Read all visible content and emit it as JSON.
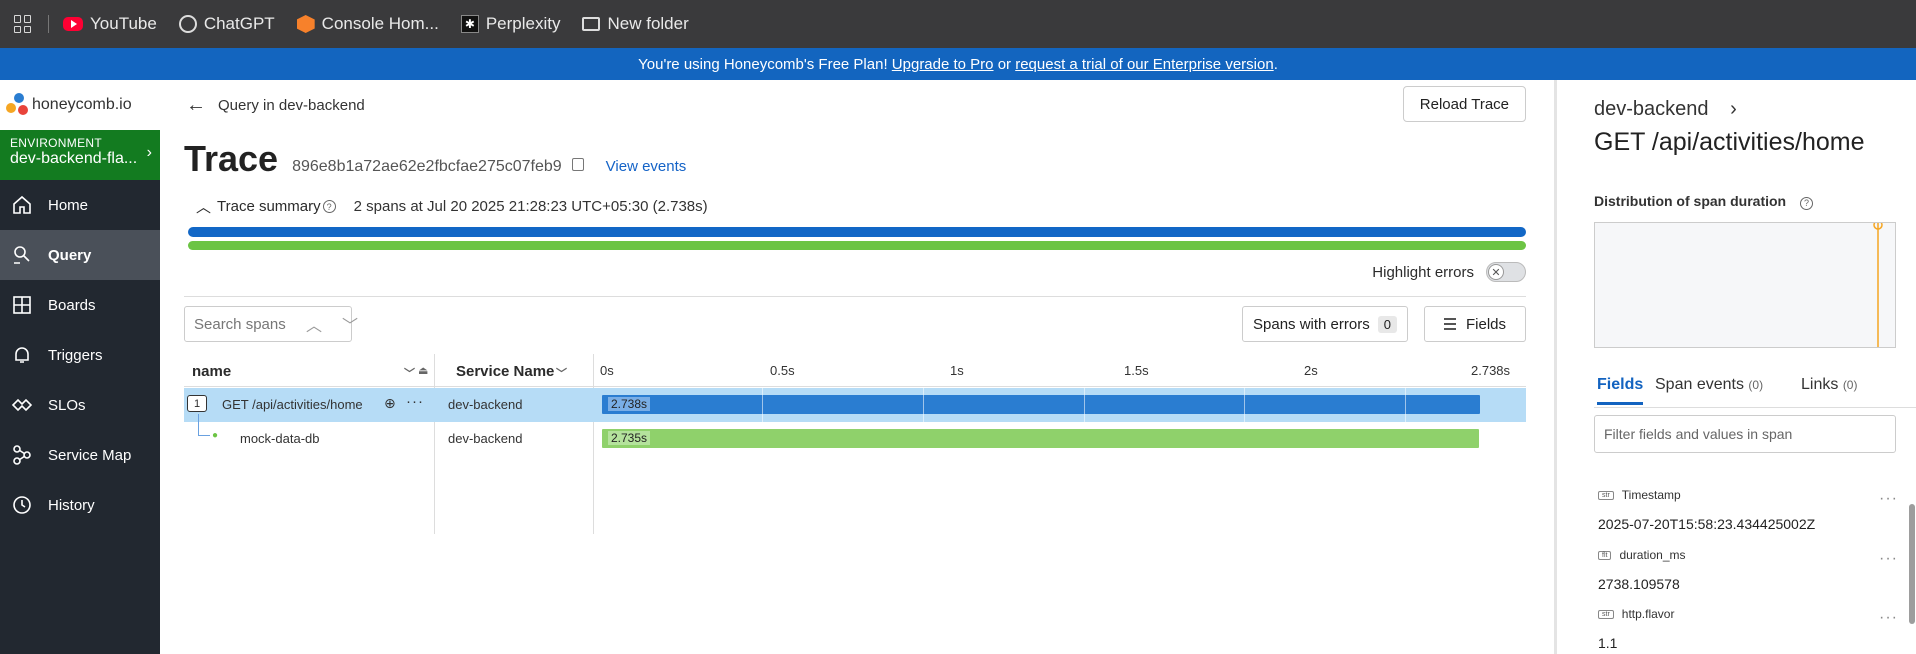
{
  "bookmarks": [
    {
      "label": "YouTube",
      "icon": "youtube-icon"
    },
    {
      "label": "ChatGPT",
      "icon": "chatgpt-icon"
    },
    {
      "label": "Console Hom...",
      "icon": "aws-icon"
    },
    {
      "label": "Perplexity",
      "icon": "perplexity-icon"
    },
    {
      "label": "New folder",
      "icon": "folder-icon"
    }
  ],
  "banner": {
    "prefix": "You're using Honeycomb's Free Plan! ",
    "upgrade": "Upgrade to Pro",
    "middle": " or ",
    "trial": "request a trial of our Enterprise version",
    "suffix": "."
  },
  "nav": {
    "logo": "honeycomb.io",
    "env_label": "ENVIRONMENT",
    "env_value": "dev-backend-fla...",
    "items": [
      {
        "label": "Home",
        "icon": "home-icon"
      },
      {
        "label": "Query",
        "icon": "query-icon",
        "active": true
      },
      {
        "label": "Boards",
        "icon": "boards-icon"
      },
      {
        "label": "Triggers",
        "icon": "bell-icon"
      },
      {
        "label": "SLOs",
        "icon": "slo-icon"
      },
      {
        "label": "Service Map",
        "icon": "service-map-icon"
      },
      {
        "label": "History",
        "icon": "history-icon"
      }
    ]
  },
  "main": {
    "back_label": "Query in dev-backend",
    "reload": "Reload Trace",
    "title": "Trace",
    "trace_id": "896e8b1a72ae62e2fbcfae275c07feb9",
    "view_events": "View events",
    "summary_label": "Trace summary",
    "summary_meta": "2 spans at Jul 20 2025 21:28:23 UTC+05:30 (2.738s)",
    "highlight_errors": "Highlight errors",
    "search_placeholder": "Search spans",
    "spans_with_errors": "Spans with errors",
    "spans_with_errors_count": "0",
    "fields": "Fields",
    "columns": {
      "name": "name",
      "service": "Service Name"
    },
    "ticks": [
      "0s",
      "0.5s",
      "1s",
      "1.5s",
      "2s",
      "2.738s"
    ],
    "rows": [
      {
        "index": "1",
        "name": "GET /api/activities/home",
        "service": "dev-backend",
        "duration": "2.738s",
        "color": "#2a7dd1"
      },
      {
        "name": "mock-data-db",
        "service": "dev-backend",
        "duration": "2.735s",
        "color": "#8fd16b"
      }
    ]
  },
  "panel": {
    "service": "dev-backend",
    "span_name": "GET /api/activities/home",
    "dist_label": "Distribution of span duration",
    "tabs": [
      {
        "label": "Fields",
        "count": ""
      },
      {
        "label": "Span events",
        "count": "(0)"
      },
      {
        "label": "Links",
        "count": "(0)"
      }
    ],
    "filter_placeholder": "Filter fields and values in span",
    "fields": [
      {
        "type": "str",
        "key": "Timestamp",
        "value": "2025-07-20T15:58:23.434425002Z"
      },
      {
        "type": "flt",
        "key": "duration_ms",
        "value": "2738.109578"
      },
      {
        "type": "str",
        "key": "http.flavor",
        "value": "1.1"
      }
    ]
  }
}
